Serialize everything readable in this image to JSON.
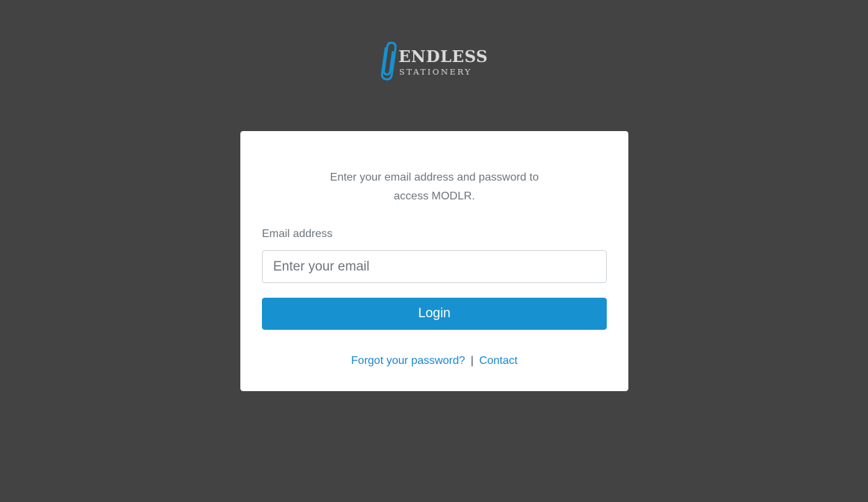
{
  "brand": {
    "name": "ENDLESS",
    "tagline": "STATIONERY",
    "icon": "paperclip-icon",
    "colors": {
      "clip": "#1791cf",
      "text": "#d9d9d9"
    }
  },
  "login": {
    "intro": "Enter your email address and password to access MODLR.",
    "email_label": "Email address",
    "email_placeholder": "Enter your email",
    "email_value": "",
    "login_label": "Login",
    "forgot_link": "Forgot your password?",
    "separator": "|",
    "contact_link": "Contact"
  },
  "colors": {
    "background": "#434343",
    "card": "#ffffff",
    "accent": "#1791cf",
    "link": "#1586d2",
    "muted_text": "#6c757d"
  }
}
